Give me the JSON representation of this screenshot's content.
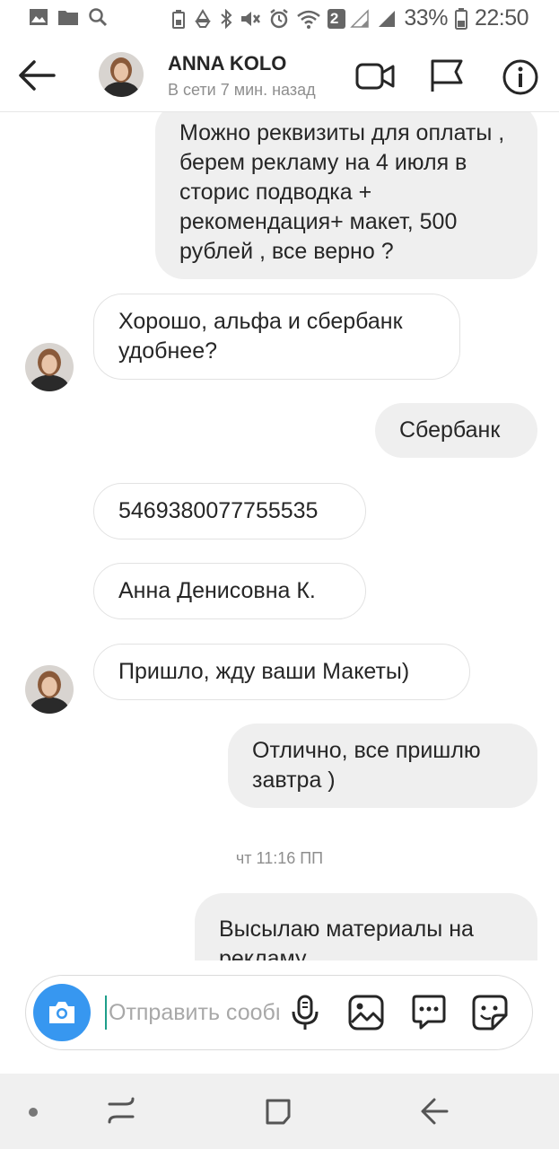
{
  "status_bar": {
    "notification_badge": "2",
    "battery": "33%",
    "time": "22:50"
  },
  "header": {
    "name": "ANNA KOLO",
    "status": "В сети 7 мин. назад"
  },
  "messages": [
    {
      "direction": "outgoing",
      "text": "Можно реквизиты для оплаты , берем рекламу на 4 июля в сторис подводка + рекомендация+ макет, 500 рублей , все верно ?"
    },
    {
      "direction": "incoming",
      "text": "Хорошо, альфа и сбербанк удобнее?"
    },
    {
      "direction": "outgoing",
      "text": "Сбербанк"
    },
    {
      "direction": "incoming",
      "text": "5469380077755535"
    },
    {
      "direction": "incoming",
      "text": "Анна Денисовна К."
    },
    {
      "direction": "incoming",
      "text": "Пришло, жду ваши Макеты)"
    },
    {
      "direction": "outgoing",
      "text": "Отлично, все пришлю завтра )"
    },
    {
      "direction": "outgoing",
      "text": "Высылаю материалы на рекламу"
    }
  ],
  "timestamp": "чт 11:16 ПП",
  "composer": {
    "placeholder": "Отправить сообщение..."
  },
  "colors": {
    "accent": "#3797f0",
    "outgoing_bubble": "#efefef",
    "incoming_border": "#e2e2e2",
    "secondary_text": "#8e8e8e"
  },
  "icons": [
    "back-arrow-icon",
    "video-call-icon",
    "flag-icon",
    "info-icon",
    "camera-icon",
    "microphone-icon",
    "gallery-icon",
    "chat-bubble-icon",
    "sticker-icon",
    "recents-icon",
    "home-icon",
    "nav-back-icon"
  ]
}
